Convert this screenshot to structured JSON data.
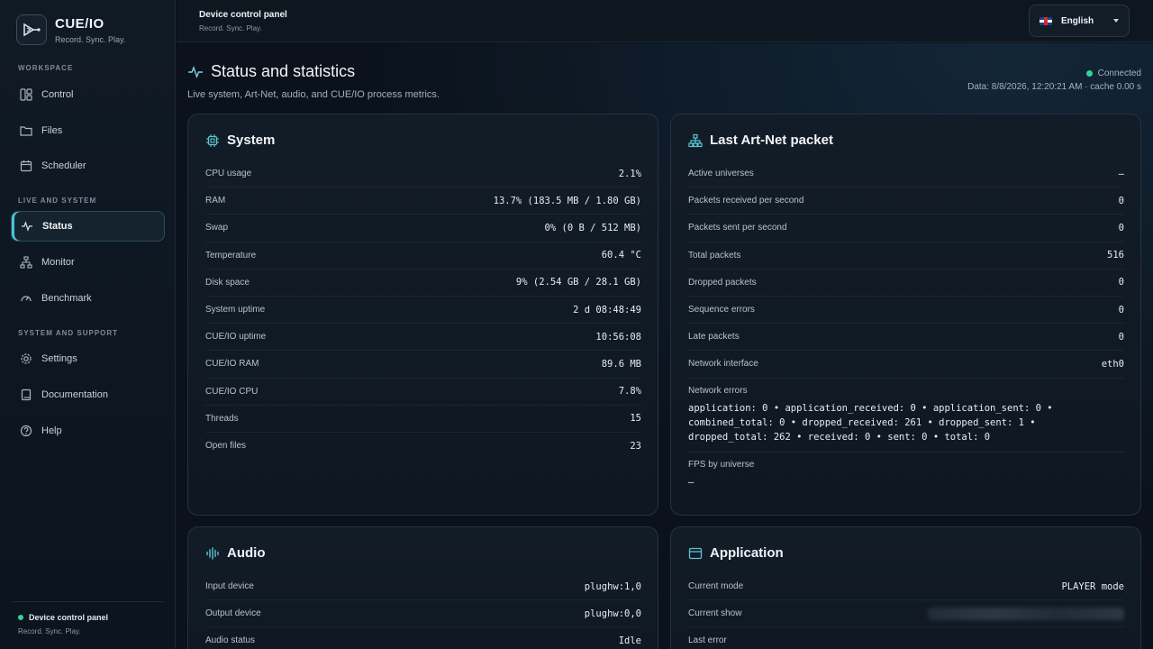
{
  "brand": {
    "name": "CUE/IO",
    "tagline": "Record. Sync. Play."
  },
  "sidebar": {
    "sections": [
      {
        "label": "WORKSPACE"
      },
      {
        "label": "LIVE AND SYSTEM"
      },
      {
        "label": "SYSTEM AND SUPPORT"
      }
    ],
    "items": [
      {
        "label": "Control",
        "icon": "dashboard-icon"
      },
      {
        "label": "Files",
        "icon": "folder-icon"
      },
      {
        "label": "Scheduler",
        "icon": "calendar-icon"
      },
      {
        "label": "Status",
        "icon": "activity-icon",
        "active": true
      },
      {
        "label": "Monitor",
        "icon": "network-icon"
      },
      {
        "label": "Benchmark",
        "icon": "gauge-icon"
      },
      {
        "label": "Settings",
        "icon": "gear-icon"
      },
      {
        "label": "Documentation",
        "icon": "book-icon"
      },
      {
        "label": "Help",
        "icon": "help-icon"
      }
    ],
    "footer": {
      "title": "Device control panel",
      "subtitle": "Record. Sync. Play."
    }
  },
  "topbar": {
    "title": "Device control panel",
    "subtitle": "Record. Sync. Play.",
    "language": "English"
  },
  "page": {
    "title": "Status and statistics",
    "subtitle": "Live system, Art-Net, audio, and CUE/IO process metrics.",
    "connection": "Connected",
    "data_info": "Data: 8/8/2026, 12:20:21 AM · cache 0.00 s"
  },
  "system": {
    "title": "System",
    "rows": [
      {
        "label": "CPU usage",
        "value": "2.1%"
      },
      {
        "label": "RAM",
        "value": "13.7% (183.5 MB / 1.80 GB)"
      },
      {
        "label": "Swap",
        "value": "0% (0 B / 512 MB)"
      },
      {
        "label": "Temperature",
        "value": "60.4 °C"
      },
      {
        "label": "Disk space",
        "value": "9% (2.54 GB / 28.1 GB)"
      },
      {
        "label": "System uptime",
        "value": "2 d 08:48:49"
      },
      {
        "label": "CUE/IO uptime",
        "value": "10:56:08"
      },
      {
        "label": "CUE/IO RAM",
        "value": "89.6 MB"
      },
      {
        "label": "CUE/IO CPU",
        "value": "7.8%"
      },
      {
        "label": "Threads",
        "value": "15"
      },
      {
        "label": "Open files",
        "value": "23"
      }
    ]
  },
  "artnet": {
    "title": "Last Art-Net packet",
    "rows": [
      {
        "label": "Active universes",
        "value": "—"
      },
      {
        "label": "Packets received per second",
        "value": "0"
      },
      {
        "label": "Packets sent per second",
        "value": "0"
      },
      {
        "label": "Total packets",
        "value": "516"
      },
      {
        "label": "Dropped packets",
        "value": "0"
      },
      {
        "label": "Sequence errors",
        "value": "0"
      },
      {
        "label": "Late packets",
        "value": "0"
      },
      {
        "label": "Network interface",
        "value": "eth0"
      }
    ],
    "network_errors_label": "Network errors",
    "network_errors_lines": [
      "application: 0 • application_received: 0 • application_sent: 0 •",
      "combined_total: 0 • dropped_received: 261 • dropped_sent: 1 •",
      "dropped_total: 262 • received: 0 • sent: 0 • total: 0"
    ],
    "fps_label": "FPS by universe",
    "fps_value": "—"
  },
  "audio": {
    "title": "Audio",
    "rows": [
      {
        "label": "Input device",
        "value": "plughw:1,0"
      },
      {
        "label": "Output device",
        "value": "plughw:0,0"
      },
      {
        "label": "Audio status",
        "value": "Idle"
      }
    ]
  },
  "application": {
    "title": "Application",
    "rows": [
      {
        "label": "Current mode",
        "value": "PLAYER mode"
      },
      {
        "label": "Current show",
        "value": ""
      },
      {
        "label": "Last error",
        "value": ""
      }
    ]
  },
  "colors": {
    "accent": "#3fc7d6",
    "connected": "#34d399",
    "background": "#0b121b"
  }
}
